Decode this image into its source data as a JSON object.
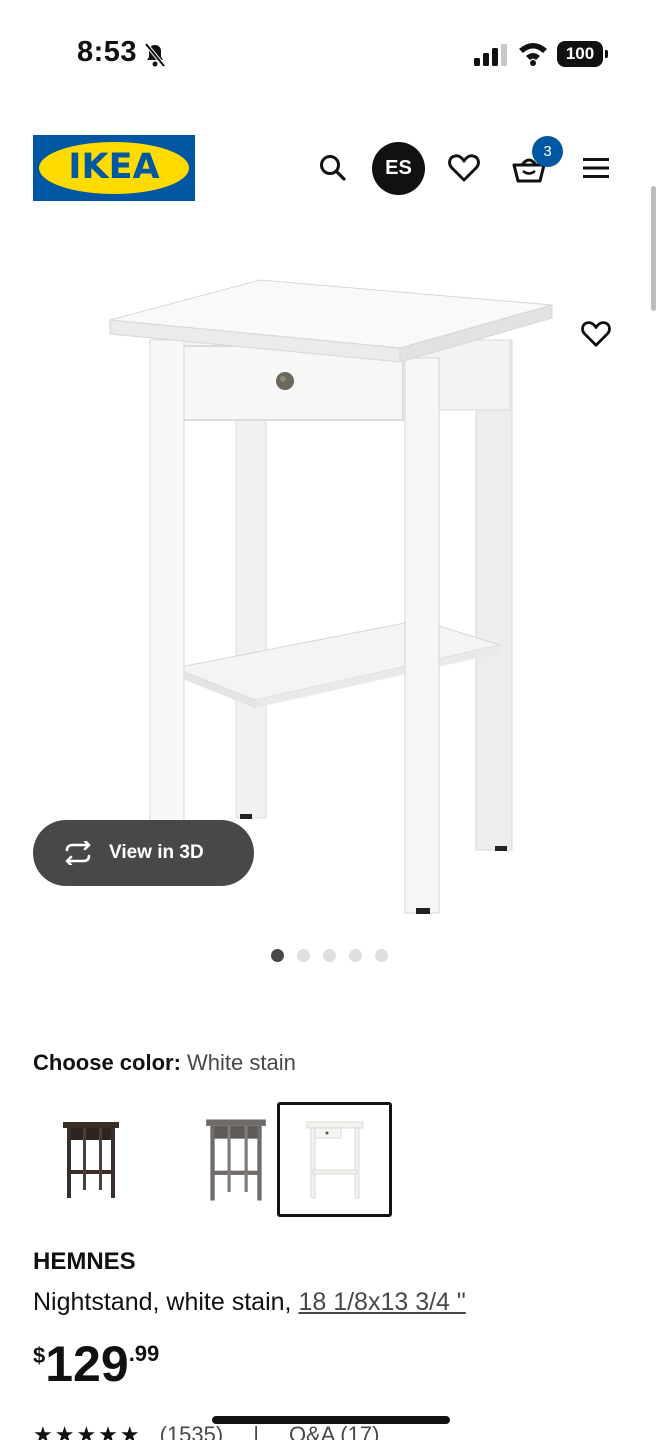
{
  "status_bar": {
    "time": "8:53",
    "battery": "100"
  },
  "header": {
    "logo_text": "IKEA",
    "language": "ES",
    "cart_count": "3"
  },
  "product_image": {
    "carousel_dots": 5,
    "active_dot": 0,
    "view_3d_label": "View in 3D"
  },
  "color_chooser": {
    "label": "Choose color:",
    "selected": "White stain",
    "swatches": [
      {
        "name": "black-brown",
        "color": "#3a2e28"
      },
      {
        "name": "dark gray",
        "color": "#6e6b69"
      },
      {
        "name": "white stain",
        "color": "#f4f2ef"
      }
    ],
    "selected_index": 2
  },
  "product": {
    "name": "HEMNES",
    "description": "Nightstand, white stain,",
    "size": "18 1/8x13 3/4 \"",
    "price_currency": "$",
    "price_integer": "129",
    "price_decimal": ".99"
  },
  "rating": {
    "stars": "★★★★★",
    "reviews": "(1535)",
    "separator": "|",
    "qa": "Q&A (17)"
  },
  "colors": {
    "brand_blue": "#0058a3",
    "brand_yellow": "#ffdb00",
    "button_dark": "#484848"
  }
}
